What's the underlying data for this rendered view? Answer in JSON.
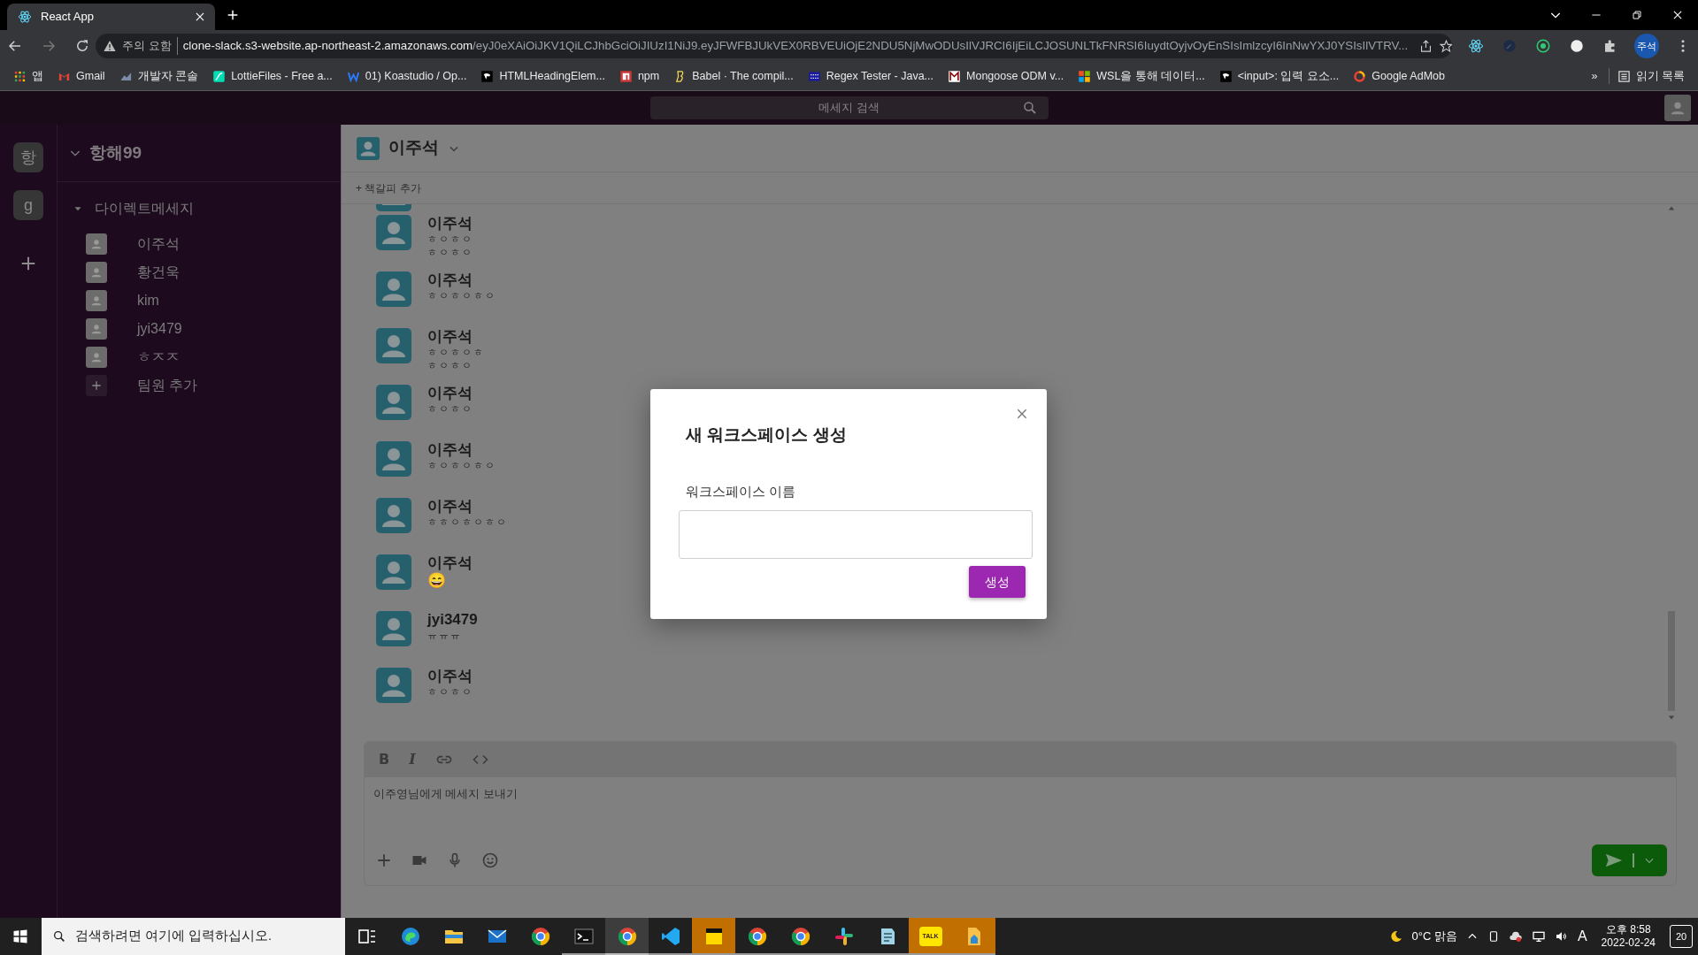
{
  "browser": {
    "tab_title": "React App",
    "warning": "주의 요함",
    "url_host": "clone-slack.s3-website.ap-northeast-2.amazonaws.com",
    "url_path": "/eyJ0eXAiOiJKV1QiLCJhbGciOiJIUzI1NiJ9.eyJFWFBJUkVEX0RBVEUiOjE2NDU5NjMwODUsIlVJRCI6IjEiLCJOSUNLTkFNRSI6IuydtOyjvOyEnSIsImlzcyI6InNwYXJ0YSIsIlVTRV...",
    "profile": "주석",
    "bookmarks": [
      {
        "kind": "apps",
        "label": "앱"
      },
      {
        "kind": "gmail",
        "label": "Gmail"
      },
      {
        "kind": "console",
        "label": "개발자 콘솔"
      },
      {
        "kind": "lottie",
        "label": "LottieFiles - Free a..."
      },
      {
        "kind": "koa",
        "label": "01) Koastudio / Op..."
      },
      {
        "kind": "mdn",
        "label": "HTMLHeadingElem..."
      },
      {
        "kind": "npm",
        "label": "npm"
      },
      {
        "kind": "babel",
        "label": "Babel · The compil..."
      },
      {
        "kind": "regex",
        "label": "Regex Tester - Java..."
      },
      {
        "kind": "mongoose",
        "label": "Mongoose ODM v..."
      },
      {
        "kind": "ms",
        "label": "WSL을 통해 데이터..."
      },
      {
        "kind": "mdn",
        "label": "<input>: 입력 요소..."
      },
      {
        "kind": "admob",
        "label": "Google AdMob"
      }
    ],
    "more": "»",
    "reading_list": "읽기 목록"
  },
  "app": {
    "search_placeholder": "메세지 검색",
    "workspaces": [
      {
        "label": "항"
      },
      {
        "label": "g"
      }
    ],
    "workspace_name": "항해99",
    "dm_section": "다이렉트메세지",
    "members": [
      "이주석",
      "황건욱",
      "kim",
      "jyi3479",
      "ㅎㅈㅈ"
    ],
    "add_member": "팀원 추가",
    "channel": {
      "name": "이주석",
      "bookmark": "+ 책갈피 추가"
    },
    "messages": [
      {
        "kind": "text",
        "author": "이주석",
        "lines": [
          "ㅎㅇㅎㅇ",
          "ㅎㅇㅎㅇ"
        ]
      },
      {
        "kind": "text",
        "author": "이주석",
        "lines": [
          "ㅎㅇㅎㅇㅎㅇ"
        ]
      },
      {
        "kind": "text",
        "author": "이주석",
        "lines": [
          "ㅎㅇㅎㅇㅎ",
          "ㅎㅇㅎㅇ"
        ]
      },
      {
        "kind": "text",
        "author": "이주석",
        "lines": [
          "ㅎㅇㅎㅇ"
        ]
      },
      {
        "kind": "text",
        "author": "이주석",
        "lines": [
          "ㅎㅇㅎㅇㅎㅇ"
        ]
      },
      {
        "kind": "text",
        "author": "이주석",
        "lines": [
          "ㅎㅎㅇㅎㅇㅎㅇ"
        ]
      },
      {
        "kind": "emoji",
        "author": "이주석",
        "lines": [
          "😄"
        ]
      },
      {
        "kind": "text",
        "author": "jyi3479",
        "lines": [
          "ㅠㅠㅠ"
        ]
      },
      {
        "kind": "text",
        "author": "이주석",
        "lines": [
          "ㅎㅇㅎㅇ"
        ]
      }
    ],
    "composer": {
      "format_buttons": [
        {
          "kind": "bold",
          "label": "B"
        },
        {
          "kind": "italic",
          "label": "I"
        },
        {
          "kind": "link"
        },
        {
          "kind": "code"
        }
      ],
      "placeholder": "이주영님에게 메세지 보내기"
    }
  },
  "modal": {
    "title": "새 워크스페이스 생성",
    "label": "워크스페이스 이름",
    "button": "생성"
  },
  "taskbar": {
    "search_placeholder": "검색하려면 여기에 입력하십시오.",
    "apps": [
      {
        "kind": "taskview",
        "running": false,
        "focused": false,
        "flashing": false
      },
      {
        "kind": "edge",
        "running": false,
        "focused": false,
        "flashing": false
      },
      {
        "kind": "explorer",
        "running": false,
        "focused": false,
        "flashing": false
      },
      {
        "kind": "mail",
        "running": false,
        "focused": false,
        "flashing": false
      },
      {
        "kind": "chrome",
        "running": false,
        "focused": false,
        "flashing": false
      },
      {
        "kind": "terminal",
        "running": true,
        "focused": false,
        "flashing": false
      },
      {
        "kind": "chrome",
        "running": true,
        "focused": true,
        "flashing": false
      },
      {
        "kind": "vscode",
        "running": true,
        "focused": false,
        "flashing": false
      },
      {
        "kind": "sticky",
        "running": true,
        "focused": false,
        "flashing": true
      },
      {
        "kind": "chrome",
        "running": true,
        "focused": false,
        "flashing": false
      },
      {
        "kind": "chrome",
        "running": true,
        "focused": false,
        "flashing": false
      },
      {
        "kind": "slack",
        "running": true,
        "focused": false,
        "flashing": false
      },
      {
        "kind": "notepad",
        "running": true,
        "focused": false,
        "flashing": false
      },
      {
        "kind": "kakao",
        "running": true,
        "focused": false,
        "flashing": true,
        "label": "TALK"
      },
      {
        "kind": "files",
        "running": true,
        "focused": false,
        "flashing": true
      }
    ],
    "weather": "0°C 맑음",
    "ime": "A",
    "time": "오후 8:58",
    "date": "2022-02-24",
    "notifications": "20"
  }
}
